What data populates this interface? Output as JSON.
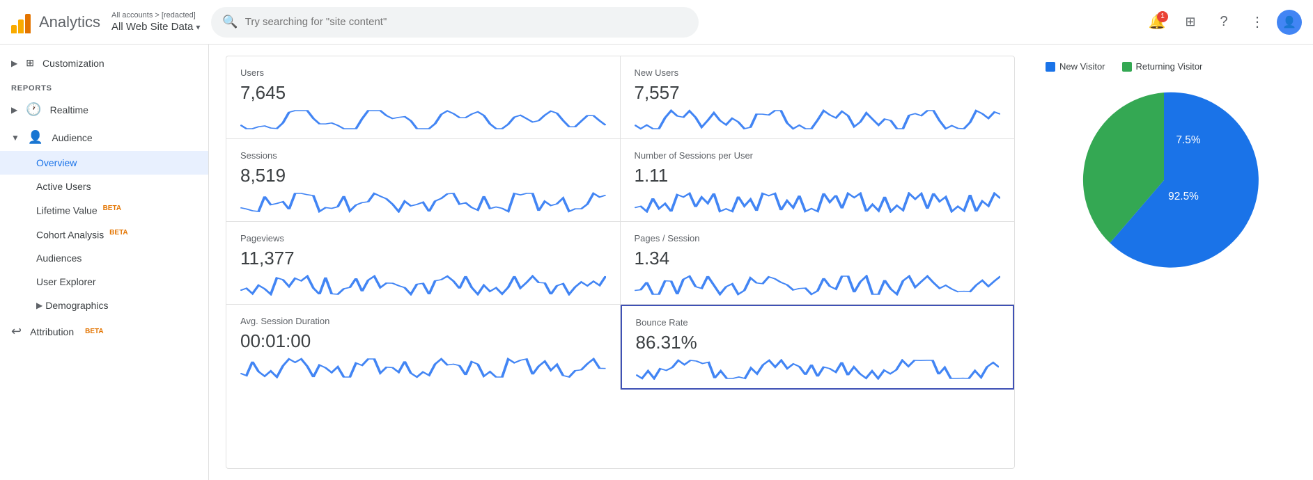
{
  "header": {
    "logo_text": "Analytics",
    "breadcrumb": "All accounts > [redacted]",
    "account_name": "All Web Site Data",
    "search_placeholder": "Try searching for \"site content\"",
    "notification_count": "1"
  },
  "sidebar": {
    "customization_label": "Customization",
    "reports_label": "REPORTS",
    "realtime_label": "Realtime",
    "audience_label": "Audience",
    "overview_label": "Overview",
    "active_users_label": "Active Users",
    "lifetime_value_label": "Lifetime Value",
    "cohort_analysis_label": "Cohort Analysis",
    "audiences_label": "Audiences",
    "user_explorer_label": "User Explorer",
    "demographics_label": "Demographics",
    "attribution_label": "Attribution",
    "beta_text": "BETA"
  },
  "metrics": [
    {
      "label": "Users",
      "value": "7,645"
    },
    {
      "label": "New Users",
      "value": "7,557"
    },
    {
      "label": "Sessions",
      "value": "8,519"
    },
    {
      "label": "Number of Sessions per User",
      "value": "1.11"
    },
    {
      "label": "Pageviews",
      "value": "11,377"
    },
    {
      "label": "Pages / Session",
      "value": "1.34"
    },
    {
      "label": "Avg. Session Duration",
      "value": "00:01:00"
    },
    {
      "label": "Bounce Rate",
      "value": "86.31%",
      "highlighted": true
    }
  ],
  "chart": {
    "new_visitor_label": "New Visitor",
    "returning_visitor_label": "Returning Visitor",
    "new_visitor_pct": "92.5%",
    "returning_visitor_pct": "7.5%",
    "new_visitor_color": "#1a73e8",
    "returning_visitor_color": "#34a853"
  }
}
